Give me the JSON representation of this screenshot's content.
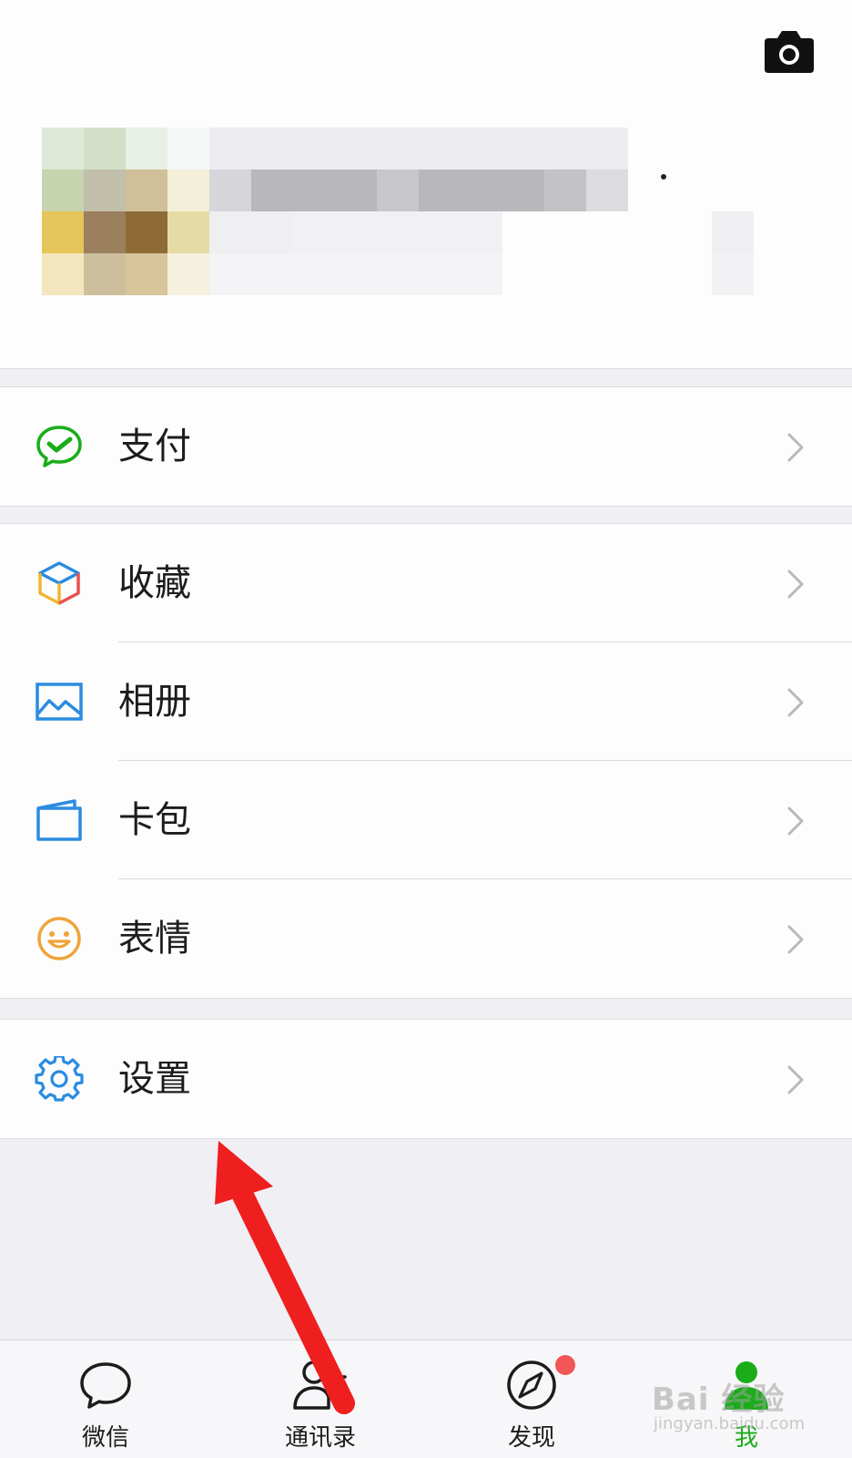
{
  "header": {
    "camera_icon": "camera-icon"
  },
  "menu": {
    "groups": [
      {
        "items": [
          {
            "label": "支付",
            "icon": "wechat-pay-icon",
            "icon_color": "#1aad19"
          }
        ]
      },
      {
        "items": [
          {
            "label": "收藏",
            "icon": "favorites-cube-icon",
            "icon_color": "#f2b531"
          },
          {
            "label": "相册",
            "icon": "album-picture-icon",
            "icon_color": "#2b8be0"
          },
          {
            "label": "卡包",
            "icon": "card-wallet-icon",
            "icon_color": "#2b8be0"
          },
          {
            "label": "表情",
            "icon": "smiley-face-icon",
            "icon_color": "#f0a43a"
          }
        ]
      },
      {
        "items": [
          {
            "label": "设置",
            "icon": "gear-icon",
            "icon_color": "#2b8be0"
          }
        ]
      }
    ]
  },
  "tabbar": {
    "tabs": [
      {
        "label": "微信",
        "icon": "chat-bubble-icon",
        "active": false
      },
      {
        "label": "通讯录",
        "icon": "contacts-icon",
        "active": false
      },
      {
        "label": "发现",
        "icon": "compass-icon",
        "active": false,
        "badge": true
      },
      {
        "label": "我",
        "icon": "me-person-icon",
        "active": true
      }
    ],
    "accent_color": "#1aad19",
    "badge_color": "#f25656"
  },
  "watermark": {
    "line1": "Bai 经验",
    "line2": "jingyan.baidu.com"
  }
}
